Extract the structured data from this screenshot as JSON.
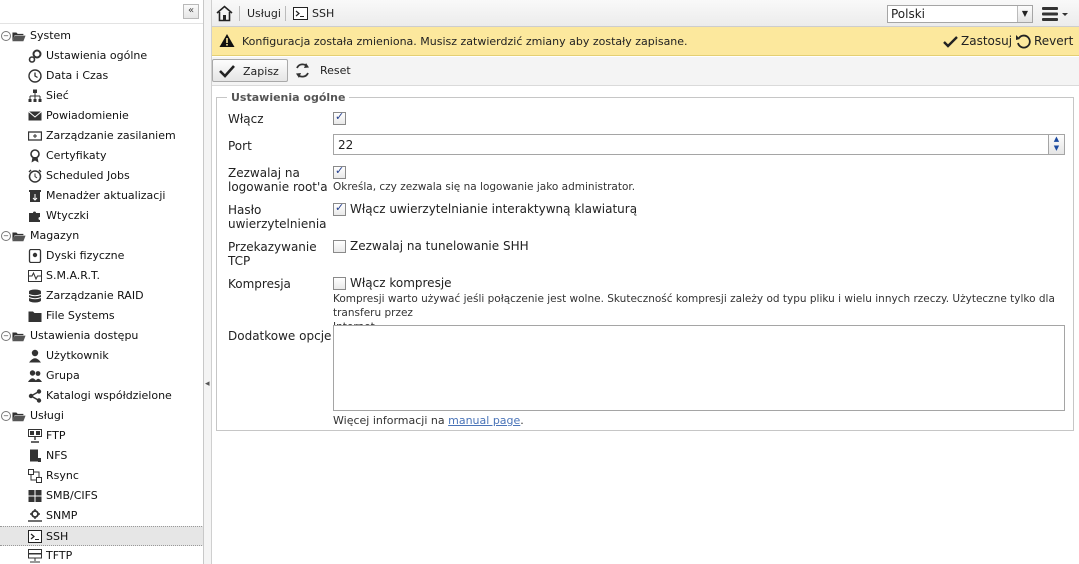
{
  "sidebar": {
    "collapse_glyph": "«",
    "items": [
      {
        "label": "System",
        "icon": "folder-open-icon",
        "level": 0
      },
      {
        "label": "Ustawienia ogólne",
        "icon": "gears-icon",
        "level": 1
      },
      {
        "label": "Data i Czas",
        "icon": "clock-icon",
        "level": 1
      },
      {
        "label": "Sieć",
        "icon": "network-icon",
        "level": 1
      },
      {
        "label": "Powiadomienie",
        "icon": "envelope-icon",
        "level": 1
      },
      {
        "label": "Zarządzanie zasilaniem",
        "icon": "power-icon",
        "level": 1
      },
      {
        "label": "Certyfikaty",
        "icon": "certificate-icon",
        "level": 1
      },
      {
        "label": "Scheduled Jobs",
        "icon": "alarm-clock-icon",
        "level": 1
      },
      {
        "label": "Menadżer aktualizacji",
        "icon": "update-icon",
        "level": 1
      },
      {
        "label": "Wtyczki",
        "icon": "puzzle-icon",
        "level": 1
      },
      {
        "label": "Magazyn",
        "icon": "folder-open-icon",
        "level": 0
      },
      {
        "label": "Dyski fizyczne",
        "icon": "disk-icon",
        "level": 1
      },
      {
        "label": "S.M.A.R.T.",
        "icon": "pulse-icon",
        "level": 1
      },
      {
        "label": "Zarządzanie RAID",
        "icon": "database-icon",
        "level": 1
      },
      {
        "label": "File Systems",
        "icon": "folder-icon",
        "level": 1
      },
      {
        "label": "Ustawienia dostępu",
        "icon": "folder-open-icon",
        "level": 0
      },
      {
        "label": "Użytkownik",
        "icon": "user-icon",
        "level": 1
      },
      {
        "label": "Grupa",
        "icon": "group-icon",
        "level": 1
      },
      {
        "label": "Katalogi współdzielone",
        "icon": "share-icon",
        "level": 1
      },
      {
        "label": "Usługi",
        "icon": "folder-open-icon",
        "level": 0
      },
      {
        "label": "FTP",
        "icon": "ftp-icon",
        "level": 1
      },
      {
        "label": "NFS",
        "icon": "nfs-icon",
        "level": 1
      },
      {
        "label": "Rsync",
        "icon": "rsync-icon",
        "level": 1
      },
      {
        "label": "SMB/CIFS",
        "icon": "windows-icon",
        "level": 1
      },
      {
        "label": "SNMP",
        "icon": "snmp-icon",
        "level": 1
      },
      {
        "label": "SSH",
        "icon": "terminal-icon",
        "level": 1,
        "selected": true
      },
      {
        "label": "TFTP",
        "icon": "tftp-icon",
        "level": 1
      }
    ]
  },
  "breadcrumb": {
    "services": "Usługi",
    "ssh": "SSH"
  },
  "language": {
    "selected": "Polski"
  },
  "alert": {
    "message": "Konfiguracja została zmieniona. Musisz zatwierdzić zmiany aby zostały zapisane.",
    "apply": "Zastosuj",
    "revert": "Revert"
  },
  "toolbar": {
    "save": "Zapisz",
    "reset": "Reset"
  },
  "form": {
    "legend": "Ustawienia ogólne",
    "enable_label": "Włącz",
    "port_label": "Port",
    "port_value": "22",
    "root_label_1": "Zezwalaj na",
    "root_label_2": "logowanie root'a",
    "root_help": "Określa, czy zezwala się na logowanie jako administrator.",
    "pwd_label_1": "Hasło",
    "pwd_label_2": "uwierzytelnienia",
    "pwd_cb_label": "Włącz uwierzytelnianie interaktywną klawiaturą",
    "tcp_label_1": "Przekazywanie",
    "tcp_label_2": "TCP",
    "tcp_cb_label": "Zezwalaj na tunelowanie SHH",
    "compress_label": "Kompresja",
    "compress_cb_label": "Włącz kompresje",
    "compress_help_1": "Kompresji warto używać jeśli połączenie jest wolne. Skuteczność kompresji zależy od typu pliku i wielu innych rzeczy. Użyteczne tylko dla transferu przez",
    "compress_help_2": "Internet.",
    "extra_label": "Dodatkowe opcje",
    "more_info": "Więcej informacji na",
    "manual_link": "manual page",
    "period": "."
  }
}
